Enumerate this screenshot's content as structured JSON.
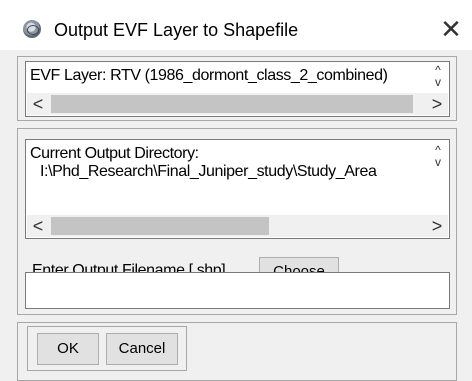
{
  "window": {
    "title": "Output EVF Layer to Shapefile",
    "close_glyph": "✕",
    "icon": "app-globe-icon"
  },
  "layer_list": {
    "item": "EVF Layer: RTV (1986_dormont_class_2_combined)",
    "scroll_up": "^",
    "scroll_down": "v",
    "scroll_left": "<",
    "scroll_right": ">"
  },
  "directory_list": {
    "line1": "Current Output Directory:",
    "line2": "I:\\Phd_Research\\Final_Juniper_study\\Study_Area",
    "scroll_up": "^",
    "scroll_down": "v",
    "scroll_left": "<",
    "scroll_right": ">"
  },
  "filename": {
    "label": "Enter Output Filename [.shp]",
    "choose_label": "Choose",
    "value": "",
    "placeholder": ""
  },
  "actions": {
    "ok_label": "OK",
    "cancel_label": "Cancel"
  }
}
